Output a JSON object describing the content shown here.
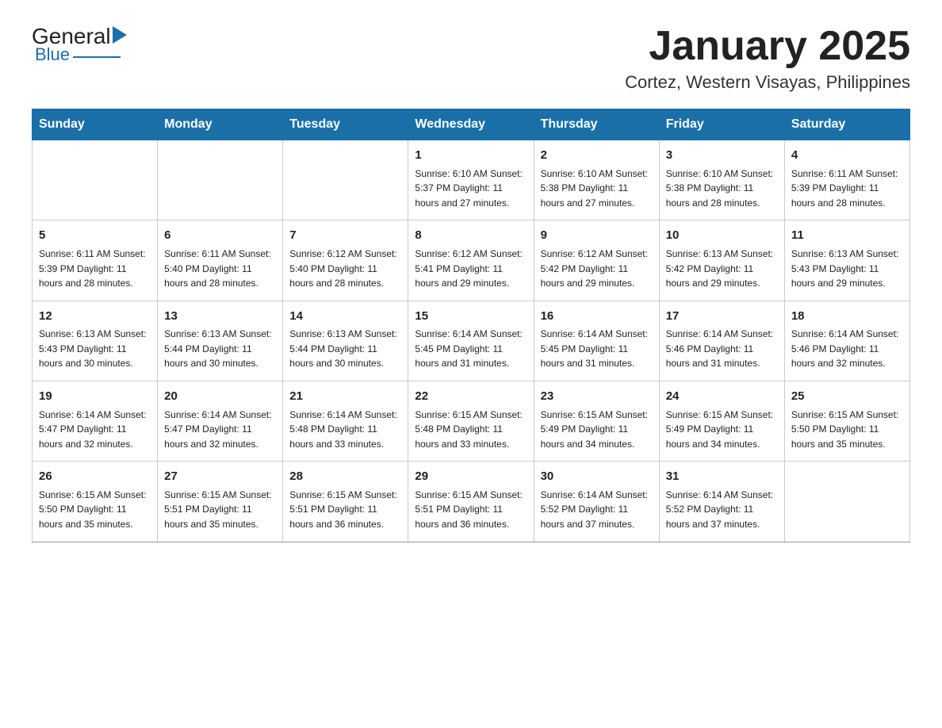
{
  "header": {
    "logo_general": "General",
    "logo_blue": "Blue",
    "month_title": "January 2025",
    "location": "Cortez, Western Visayas, Philippines"
  },
  "calendar": {
    "days_of_week": [
      "Sunday",
      "Monday",
      "Tuesday",
      "Wednesday",
      "Thursday",
      "Friday",
      "Saturday"
    ],
    "weeks": [
      [
        {
          "day": "",
          "info": ""
        },
        {
          "day": "",
          "info": ""
        },
        {
          "day": "",
          "info": ""
        },
        {
          "day": "1",
          "info": "Sunrise: 6:10 AM\nSunset: 5:37 PM\nDaylight: 11 hours and 27 minutes."
        },
        {
          "day": "2",
          "info": "Sunrise: 6:10 AM\nSunset: 5:38 PM\nDaylight: 11 hours and 27 minutes."
        },
        {
          "day": "3",
          "info": "Sunrise: 6:10 AM\nSunset: 5:38 PM\nDaylight: 11 hours and 28 minutes."
        },
        {
          "day": "4",
          "info": "Sunrise: 6:11 AM\nSunset: 5:39 PM\nDaylight: 11 hours and 28 minutes."
        }
      ],
      [
        {
          "day": "5",
          "info": "Sunrise: 6:11 AM\nSunset: 5:39 PM\nDaylight: 11 hours and 28 minutes."
        },
        {
          "day": "6",
          "info": "Sunrise: 6:11 AM\nSunset: 5:40 PM\nDaylight: 11 hours and 28 minutes."
        },
        {
          "day": "7",
          "info": "Sunrise: 6:12 AM\nSunset: 5:40 PM\nDaylight: 11 hours and 28 minutes."
        },
        {
          "day": "8",
          "info": "Sunrise: 6:12 AM\nSunset: 5:41 PM\nDaylight: 11 hours and 29 minutes."
        },
        {
          "day": "9",
          "info": "Sunrise: 6:12 AM\nSunset: 5:42 PM\nDaylight: 11 hours and 29 minutes."
        },
        {
          "day": "10",
          "info": "Sunrise: 6:13 AM\nSunset: 5:42 PM\nDaylight: 11 hours and 29 minutes."
        },
        {
          "day": "11",
          "info": "Sunrise: 6:13 AM\nSunset: 5:43 PM\nDaylight: 11 hours and 29 minutes."
        }
      ],
      [
        {
          "day": "12",
          "info": "Sunrise: 6:13 AM\nSunset: 5:43 PM\nDaylight: 11 hours and 30 minutes."
        },
        {
          "day": "13",
          "info": "Sunrise: 6:13 AM\nSunset: 5:44 PM\nDaylight: 11 hours and 30 minutes."
        },
        {
          "day": "14",
          "info": "Sunrise: 6:13 AM\nSunset: 5:44 PM\nDaylight: 11 hours and 30 minutes."
        },
        {
          "day": "15",
          "info": "Sunrise: 6:14 AM\nSunset: 5:45 PM\nDaylight: 11 hours and 31 minutes."
        },
        {
          "day": "16",
          "info": "Sunrise: 6:14 AM\nSunset: 5:45 PM\nDaylight: 11 hours and 31 minutes."
        },
        {
          "day": "17",
          "info": "Sunrise: 6:14 AM\nSunset: 5:46 PM\nDaylight: 11 hours and 31 minutes."
        },
        {
          "day": "18",
          "info": "Sunrise: 6:14 AM\nSunset: 5:46 PM\nDaylight: 11 hours and 32 minutes."
        }
      ],
      [
        {
          "day": "19",
          "info": "Sunrise: 6:14 AM\nSunset: 5:47 PM\nDaylight: 11 hours and 32 minutes."
        },
        {
          "day": "20",
          "info": "Sunrise: 6:14 AM\nSunset: 5:47 PM\nDaylight: 11 hours and 32 minutes."
        },
        {
          "day": "21",
          "info": "Sunrise: 6:14 AM\nSunset: 5:48 PM\nDaylight: 11 hours and 33 minutes."
        },
        {
          "day": "22",
          "info": "Sunrise: 6:15 AM\nSunset: 5:48 PM\nDaylight: 11 hours and 33 minutes."
        },
        {
          "day": "23",
          "info": "Sunrise: 6:15 AM\nSunset: 5:49 PM\nDaylight: 11 hours and 34 minutes."
        },
        {
          "day": "24",
          "info": "Sunrise: 6:15 AM\nSunset: 5:49 PM\nDaylight: 11 hours and 34 minutes."
        },
        {
          "day": "25",
          "info": "Sunrise: 6:15 AM\nSunset: 5:50 PM\nDaylight: 11 hours and 35 minutes."
        }
      ],
      [
        {
          "day": "26",
          "info": "Sunrise: 6:15 AM\nSunset: 5:50 PM\nDaylight: 11 hours and 35 minutes."
        },
        {
          "day": "27",
          "info": "Sunrise: 6:15 AM\nSunset: 5:51 PM\nDaylight: 11 hours and 35 minutes."
        },
        {
          "day": "28",
          "info": "Sunrise: 6:15 AM\nSunset: 5:51 PM\nDaylight: 11 hours and 36 minutes."
        },
        {
          "day": "29",
          "info": "Sunrise: 6:15 AM\nSunset: 5:51 PM\nDaylight: 11 hours and 36 minutes."
        },
        {
          "day": "30",
          "info": "Sunrise: 6:14 AM\nSunset: 5:52 PM\nDaylight: 11 hours and 37 minutes."
        },
        {
          "day": "31",
          "info": "Sunrise: 6:14 AM\nSunset: 5:52 PM\nDaylight: 11 hours and 37 minutes."
        },
        {
          "day": "",
          "info": ""
        }
      ]
    ]
  }
}
